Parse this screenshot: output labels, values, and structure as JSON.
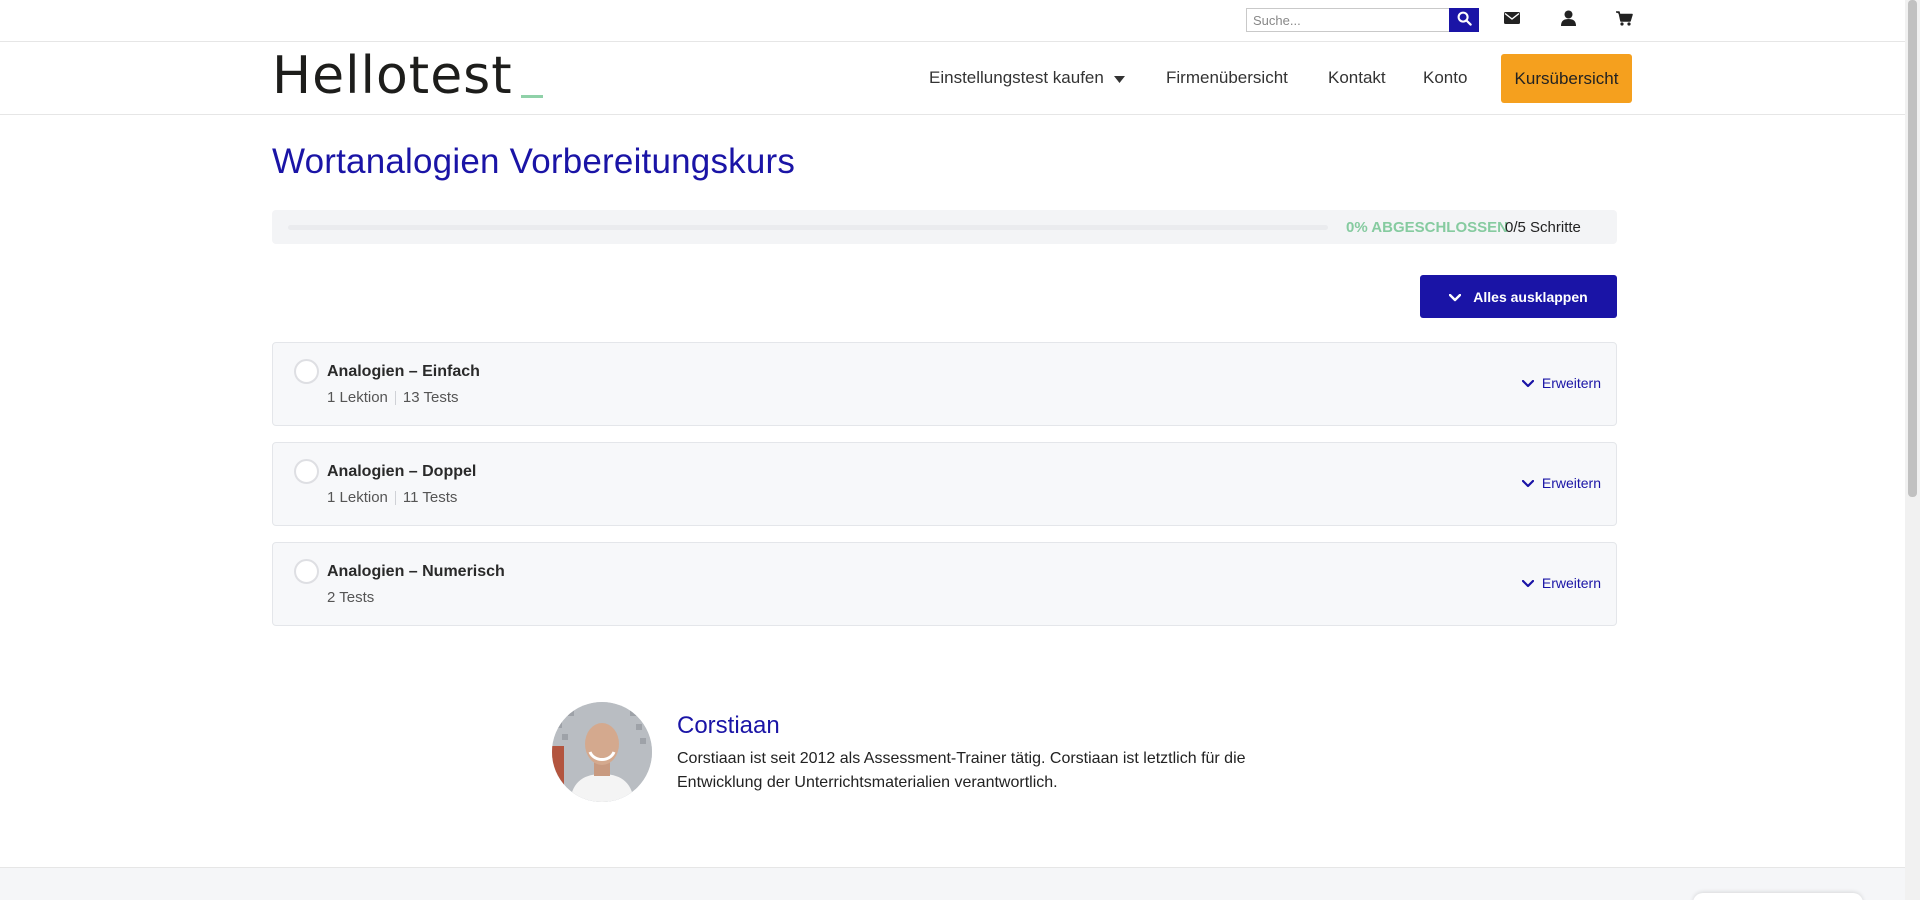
{
  "topbar": {
    "search_placeholder": "Suche...",
    "search_button_icon": "search-icon",
    "icons": [
      "mail-icon",
      "user-icon",
      "cart-icon"
    ]
  },
  "nav": {
    "logo_text": "Hellotest",
    "items": [
      {
        "label": "Einstellungstest kaufen",
        "has_dropdown": true
      },
      {
        "label": "Firmenübersicht"
      },
      {
        "label": "Kontakt"
      },
      {
        "label": "Konto"
      }
    ],
    "cta_label": "Kursübersicht"
  },
  "course": {
    "title": "Wortanalogien Vorbereitungskurs",
    "progress": {
      "percent": 0,
      "percent_label": "0% ABGESCHLOSSEN",
      "steps_label": "0/5 Schritte"
    },
    "expand_all_label": "Alles ausklappen",
    "sections": [
      {
        "title": "Analogien – Einfach",
        "lessons": "1 Lektion",
        "tests": "13 Tests",
        "expand_label": "Erweitern"
      },
      {
        "title": "Analogien – Doppel",
        "lessons": "1 Lektion",
        "tests": "11 Tests",
        "expand_label": "Erweitern"
      },
      {
        "title": "Analogien – Numerisch",
        "tests": "2 Tests",
        "expand_label": "Erweitern"
      }
    ]
  },
  "author": {
    "name": "Corstiaan",
    "bio": "Corstiaan ist seit 2012 als Assessment-Trainer tätig. Corstiaan ist letztlich für die Entwicklung der Unterrichtsmaterialien verantwortlich."
  },
  "colors": {
    "brand_blue": "#1a14a6",
    "accent_orange": "#f5a01e",
    "progress_green": "#86cba0"
  }
}
